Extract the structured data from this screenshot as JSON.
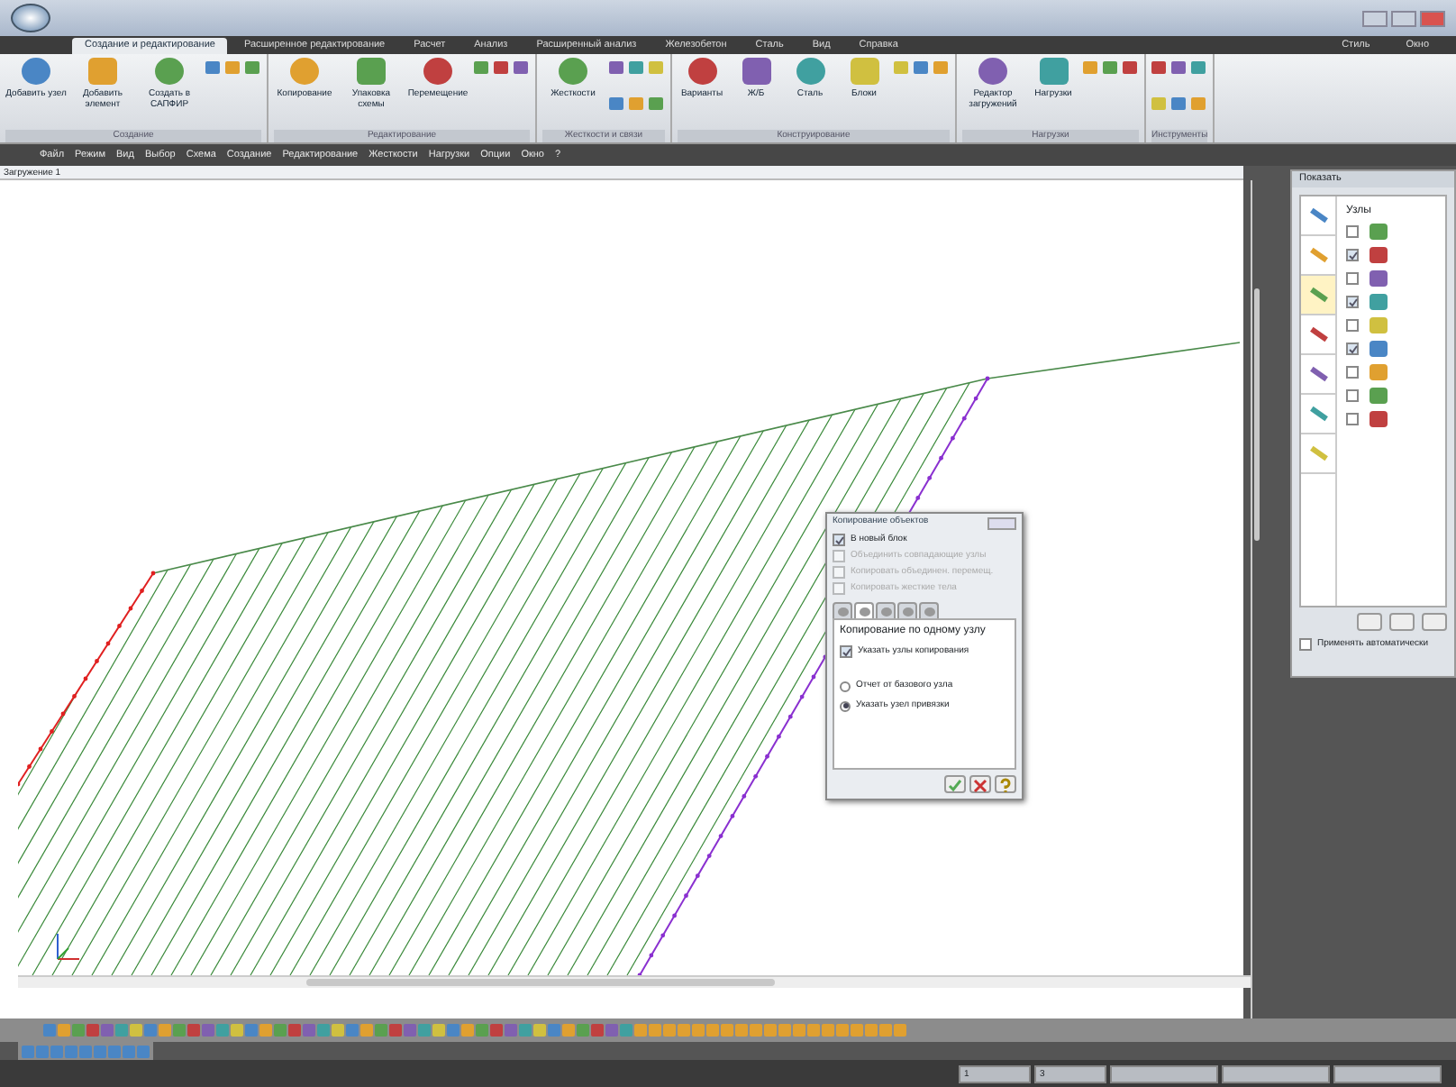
{
  "ribbon_tabs": [
    {
      "label": "Создание и редактирование",
      "selected": true
    },
    {
      "label": "Расширенное редактирование",
      "selected": false
    },
    {
      "label": "Расчет",
      "selected": false
    },
    {
      "label": "Анализ",
      "selected": false
    },
    {
      "label": "Расширенный анализ",
      "selected": false
    },
    {
      "label": "Железобетон",
      "selected": false
    },
    {
      "label": "Сталь",
      "selected": false
    },
    {
      "label": "Вид",
      "selected": false
    },
    {
      "label": "Справка",
      "selected": false
    }
  ],
  "ribbon_right": [
    "Стиль",
    "Окно"
  ],
  "ribbon_groups": [
    {
      "label": "Создание",
      "buttons": [
        "Добавить узел",
        "Добавить элемент",
        "Создать в САПФИР"
      ]
    },
    {
      "label": "Редактирование",
      "buttons": [
        "Копирование",
        "Упаковка схемы",
        "Перемещение"
      ]
    },
    {
      "label": "Жесткости и связи",
      "buttons": [
        "Жесткости"
      ]
    },
    {
      "label": "Конструирование",
      "buttons": [
        "Варианты",
        "Ж/Б",
        "Сталь",
        "Блоки"
      ]
    },
    {
      "label": "Нагрузки",
      "buttons": [
        "Редактор загружений",
        "Нагрузки"
      ]
    },
    {
      "label": "Инструменты"
    }
  ],
  "menu": [
    "Файл",
    "Режим",
    "Вид",
    "Выбор",
    "Схема",
    "Создание",
    "Редактирование",
    "Жесткости",
    "Нагрузки",
    "Опции",
    "Окно",
    "?"
  ],
  "document_tab": "Загружение 1",
  "dialog": {
    "title": "Копирование объектов",
    "options": [
      {
        "label": "В новый блок",
        "checked": true,
        "disabled": false
      },
      {
        "label": "Объединить совпадающие узлы",
        "checked": false,
        "disabled": true
      },
      {
        "label": "Копировать объединен. перемещ.",
        "checked": false,
        "disabled": true
      },
      {
        "label": "Копировать жесткие тела",
        "checked": false,
        "disabled": true
      }
    ],
    "mode_tabs": [
      {
        "selected": false
      },
      {
        "selected": true
      },
      {
        "selected": false
      },
      {
        "selected": false
      },
      {
        "selected": false
      }
    ],
    "section_title": "Копирование по одному узлу",
    "section_option": {
      "label": "Указать узлы копирования",
      "checked": true
    },
    "radios": [
      {
        "label": "Отчет от базового узла",
        "selected": false
      },
      {
        "label": "Указать узел привязки",
        "selected": true
      }
    ]
  },
  "show_panel": {
    "title": "Показать",
    "header": "Узлы",
    "side_tools": [
      {
        "selected": false
      },
      {
        "selected": false
      },
      {
        "selected": true
      },
      {
        "selected": false
      },
      {
        "selected": false
      },
      {
        "selected": false
      },
      {
        "selected": false
      }
    ],
    "items": [
      {
        "checked": false
      },
      {
        "checked": true
      },
      {
        "checked": false
      },
      {
        "checked": true
      },
      {
        "checked": false
      },
      {
        "checked": true
      },
      {
        "checked": false
      },
      {
        "checked": false
      },
      {
        "checked": false
      }
    ],
    "auto_apply": {
      "label": "Применять автоматически",
      "checked": false
    }
  },
  "status_bar": {
    "fields": [
      "1",
      "3"
    ]
  }
}
